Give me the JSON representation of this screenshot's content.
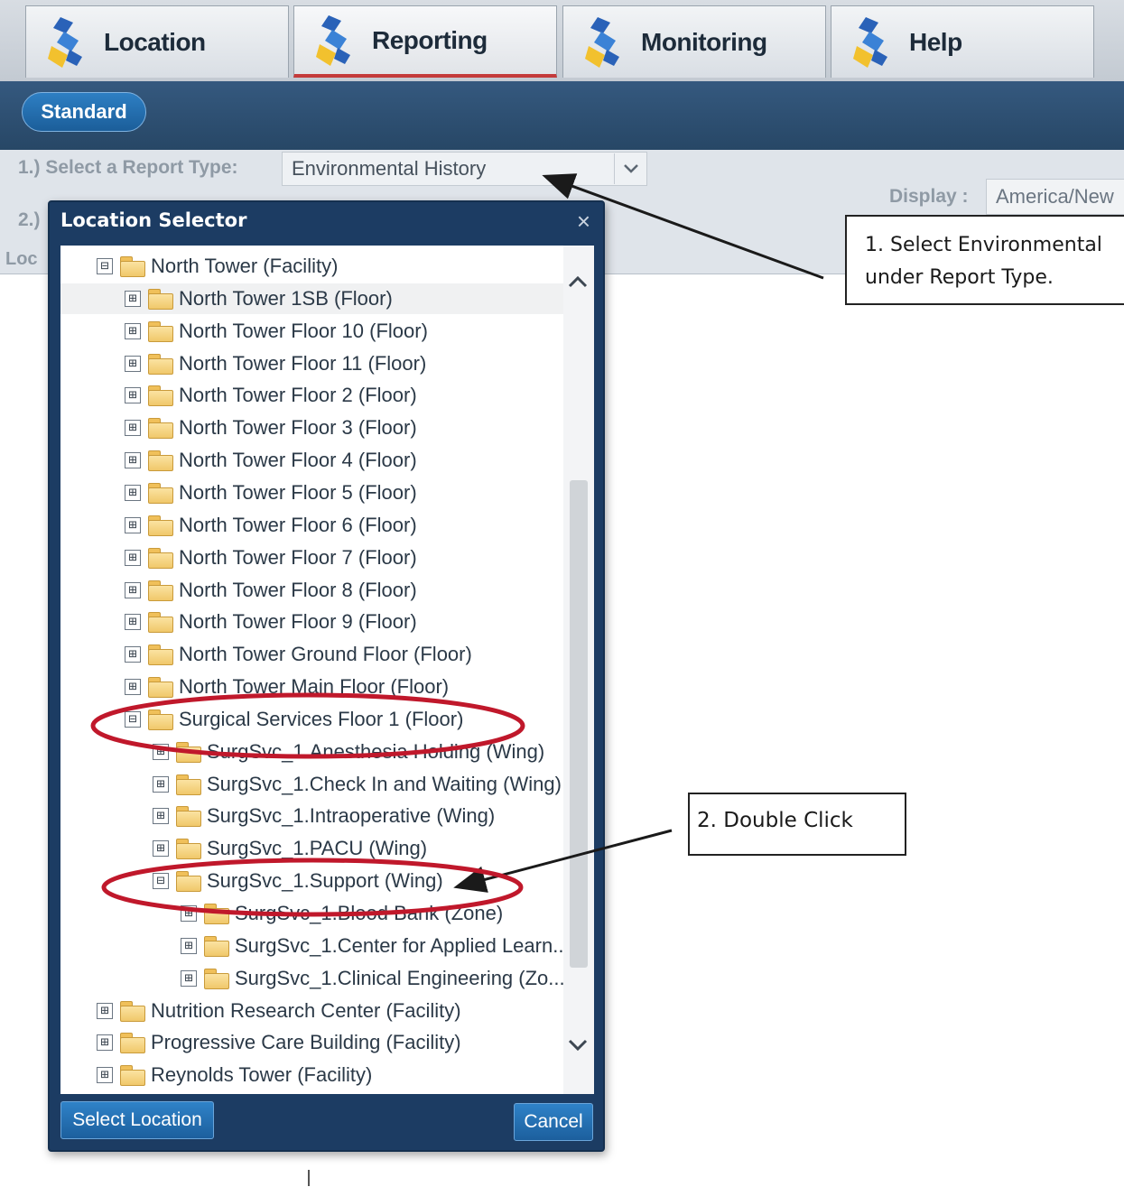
{
  "tabs": [
    {
      "label": "Location"
    },
    {
      "label": "Reporting"
    },
    {
      "label": "Monitoring"
    },
    {
      "label": "Help"
    }
  ],
  "subnav": {
    "standard_label": "Standard"
  },
  "report": {
    "step1_label": "1.) Select a Report Type:",
    "report_type_value": "Environmental History",
    "step2_label": "2.)",
    "location_label": "Loc",
    "display_label": "Display :",
    "display_value": "America/New"
  },
  "dialog": {
    "title": "Location Selector",
    "close_glyph": "×",
    "select_button": "Select Location",
    "cancel_button": "Cancel",
    "tree": [
      {
        "label": "North Tower (Facility)",
        "toggle": "⊟",
        "level": 0
      },
      {
        "label": "North Tower 1SB (Floor)",
        "toggle": "⊞",
        "level": 1
      },
      {
        "label": "North Tower Floor 10 (Floor)",
        "toggle": "⊞",
        "level": 1
      },
      {
        "label": "North Tower Floor 11 (Floor)",
        "toggle": "⊞",
        "level": 1
      },
      {
        "label": "North Tower Floor 2 (Floor)",
        "toggle": "⊞",
        "level": 1
      },
      {
        "label": "North Tower Floor 3 (Floor)",
        "toggle": "⊞",
        "level": 1
      },
      {
        "label": "North Tower Floor 4 (Floor)",
        "toggle": "⊞",
        "level": 1
      },
      {
        "label": "North Tower Floor 5 (Floor)",
        "toggle": "⊞",
        "level": 1
      },
      {
        "label": "North Tower Floor 6 (Floor)",
        "toggle": "⊞",
        "level": 1
      },
      {
        "label": "North Tower Floor 7 (Floor)",
        "toggle": "⊞",
        "level": 1
      },
      {
        "label": "North Tower Floor 8 (Floor)",
        "toggle": "⊞",
        "level": 1
      },
      {
        "label": "North Tower Floor 9 (Floor)",
        "toggle": "⊞",
        "level": 1
      },
      {
        "label": "North Tower Ground Floor (Floor)",
        "toggle": "⊞",
        "level": 1
      },
      {
        "label": "North Tower Main Floor (Floor)",
        "toggle": "⊞",
        "level": 1
      },
      {
        "label": "Surgical Services Floor 1 (Floor)",
        "toggle": "⊟",
        "level": 1
      },
      {
        "label": "SurgSvc_1.Anesthesia Holding (Wing)",
        "toggle": "⊞",
        "level": 2
      },
      {
        "label": "SurgSvc_1.Check In and Waiting (Wing)",
        "toggle": "⊞",
        "level": 2
      },
      {
        "label": "SurgSvc_1.Intraoperative (Wing)",
        "toggle": "⊞",
        "level": 2
      },
      {
        "label": "SurgSvc_1.PACU (Wing)",
        "toggle": "⊞",
        "level": 2
      },
      {
        "label": "SurgSvc_1.Support (Wing)",
        "toggle": "⊟",
        "level": 2
      },
      {
        "label": "SurgSvc_1.Blood Bank (Zone)",
        "toggle": "⊞",
        "level": 3
      },
      {
        "label": "SurgSvc_1.Center for Applied Learn...",
        "toggle": "⊞",
        "level": 3
      },
      {
        "label": "SurgSvc_1.Clinical Engineering (Zo...",
        "toggle": "⊞",
        "level": 3
      },
      {
        "label": "Nutrition Research Center (Facility)",
        "toggle": "⊞",
        "level": 0
      },
      {
        "label": "Progressive Care Building (Facility)",
        "toggle": "⊞",
        "level": 0
      },
      {
        "label": "Reynolds Tower (Facility)",
        "toggle": "⊞",
        "level": 0
      }
    ]
  },
  "callouts": {
    "callout1_line1": "1. Select Environmental",
    "callout1_line2": "under Report Type.",
    "callout2": "2. Double Click"
  },
  "colors": {
    "annotation_red": "#c0182b",
    "dialog_blue": "#1c3c63",
    "active_tab_underline": "#c43a3a"
  }
}
